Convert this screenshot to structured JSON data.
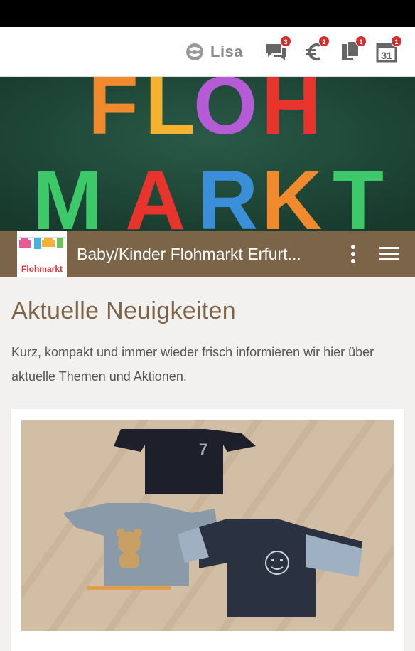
{
  "topbar": {
    "user_name": "Lisa",
    "badges": {
      "messages": "3",
      "payments": "2",
      "documents": "1",
      "calendar": "1"
    }
  },
  "hero": {
    "line1": "FLOH",
    "line2": "MARKT"
  },
  "brandbar": {
    "logo_text": "Flohmarkt",
    "title": "Baby/Kinder Flohmarkt Erfurt..."
  },
  "news": {
    "heading": "Aktuelle Neuigkeiten",
    "intro": "Kurz, kompakt und immer wieder frisch informieren wir hier über aktuelle Themen und Aktionen."
  },
  "colors": {
    "brand": "#7b6448",
    "badge": "#d32f2f",
    "hero_bg": "#1f4a3a"
  },
  "icons": [
    "logo-swirl-icon",
    "chat-icon",
    "euro-icon",
    "documents-icon",
    "calendar-icon",
    "more-vert-icon",
    "menu-icon"
  ]
}
